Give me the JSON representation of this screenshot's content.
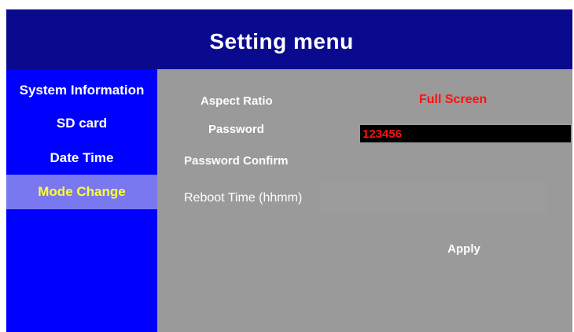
{
  "header": {
    "title": "Setting menu"
  },
  "sidebar": {
    "items": [
      {
        "label": "System Information",
        "active": false
      },
      {
        "label": "SD card",
        "active": false
      },
      {
        "label": "Date Time",
        "active": false
      },
      {
        "label": "Mode Change",
        "active": true
      }
    ]
  },
  "form": {
    "aspect_ratio_label": "Aspect Ratio",
    "aspect_ratio_value": "Full Screen",
    "password_label": "Password",
    "password_value": "123456",
    "password_confirm_label": "Password Confirm",
    "password_confirm_value": "",
    "reboot_time_label": "Reboot Time (hhmm)",
    "reboot_time_value": "",
    "apply_label": "Apply"
  },
  "colors": {
    "header_bg": "#0a0a8e",
    "sidebar_bg": "#0000ff",
    "active_item_bg": "#7a78f0",
    "active_item_text": "#ffff33",
    "content_bg": "#9a9a9a",
    "value_red": "#ff1010"
  }
}
